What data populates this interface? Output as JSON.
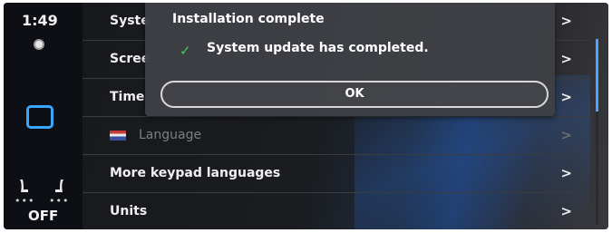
{
  "status_rail": {
    "clock": "1:49",
    "seat_off_label": "OFF"
  },
  "settings_menu": {
    "items": [
      {
        "label": "Syste",
        "chevron": ">"
      },
      {
        "label": "Scree",
        "chevron": ">"
      },
      {
        "label": "Time",
        "chevron": ">"
      },
      {
        "label": "Language",
        "chevron": ">"
      },
      {
        "label": "More keypad languages",
        "chevron": ">"
      },
      {
        "label": "Units",
        "chevron": ">"
      }
    ]
  },
  "popup": {
    "title": "Installation complete",
    "message": "System update has completed.",
    "check_glyph": "✓",
    "ok_label": "OK"
  },
  "icons": {
    "check": "check-icon",
    "home": "home-icon",
    "seat_heat_left": "seat-heat-icon",
    "seat_heat_right": "seat-heat-icon"
  },
  "colors": {
    "accent": "#3aa7ff",
    "check": "#3ecf5a",
    "popup_bg": "#3e4044"
  }
}
